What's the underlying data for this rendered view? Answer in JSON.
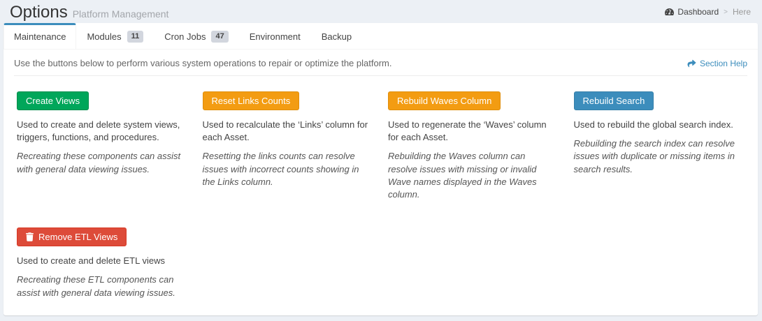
{
  "header": {
    "title": "Options",
    "subtitle": "Platform Management",
    "breadcrumb": {
      "home": "Dashboard",
      "separator": ">",
      "current": "Here"
    }
  },
  "tabs": [
    {
      "label": "Maintenance",
      "active": true
    },
    {
      "label": "Modules",
      "badge": "11"
    },
    {
      "label": "Cron Jobs",
      "badge": "47"
    },
    {
      "label": "Environment"
    },
    {
      "label": "Backup"
    }
  ],
  "maintenance": {
    "intro": "Use the buttons below to perform various system operations to repair or optimize the platform.",
    "section_help_label": "Section Help",
    "actions": [
      {
        "button": "Create Views",
        "color": "#00a65a",
        "description": "Used to create and delete system views, triggers, functions, and procedures.",
        "note": "Recreating these components can assist with general data viewing issues."
      },
      {
        "button": "Reset Links Counts",
        "color": "#f39c12",
        "description": "Used to recalculate the ‘Links’ column for each Asset.",
        "note": "Resetting the links counts can resolve issues with incorrect counts showing in the Links column."
      },
      {
        "button": "Rebuild Waves Column",
        "color": "#f39c12",
        "description": "Used to regenerate the ‘Waves’ column for each Asset.",
        "note": "Rebuilding the Waves column can resolve issues with missing or invalid Wave names displayed in the Waves column."
      },
      {
        "button": "Rebuild Search",
        "color": "#3c8dbc",
        "description": "Used to rebuild the global search index.",
        "note": "Rebuilding the search index can resolve issues with duplicate or missing items in search results."
      }
    ],
    "etl": {
      "button": "Remove ETL Views",
      "color": "#dd4b39",
      "description": "Used to create and delete ETL views",
      "note": "Recreating these ETL components can assist with general data viewing issues."
    }
  },
  "colors": {
    "page_background": "#ecf0f5",
    "card_background": "#ffffff",
    "active_tab_accent": "#3c8dbc",
    "link_blue": "#3c8dbc",
    "badge_background": "#d2d6de",
    "button_green": "#00a65a",
    "button_orange": "#f39c12",
    "button_blue": "#3c8dbc",
    "button_red": "#dd4b39"
  }
}
